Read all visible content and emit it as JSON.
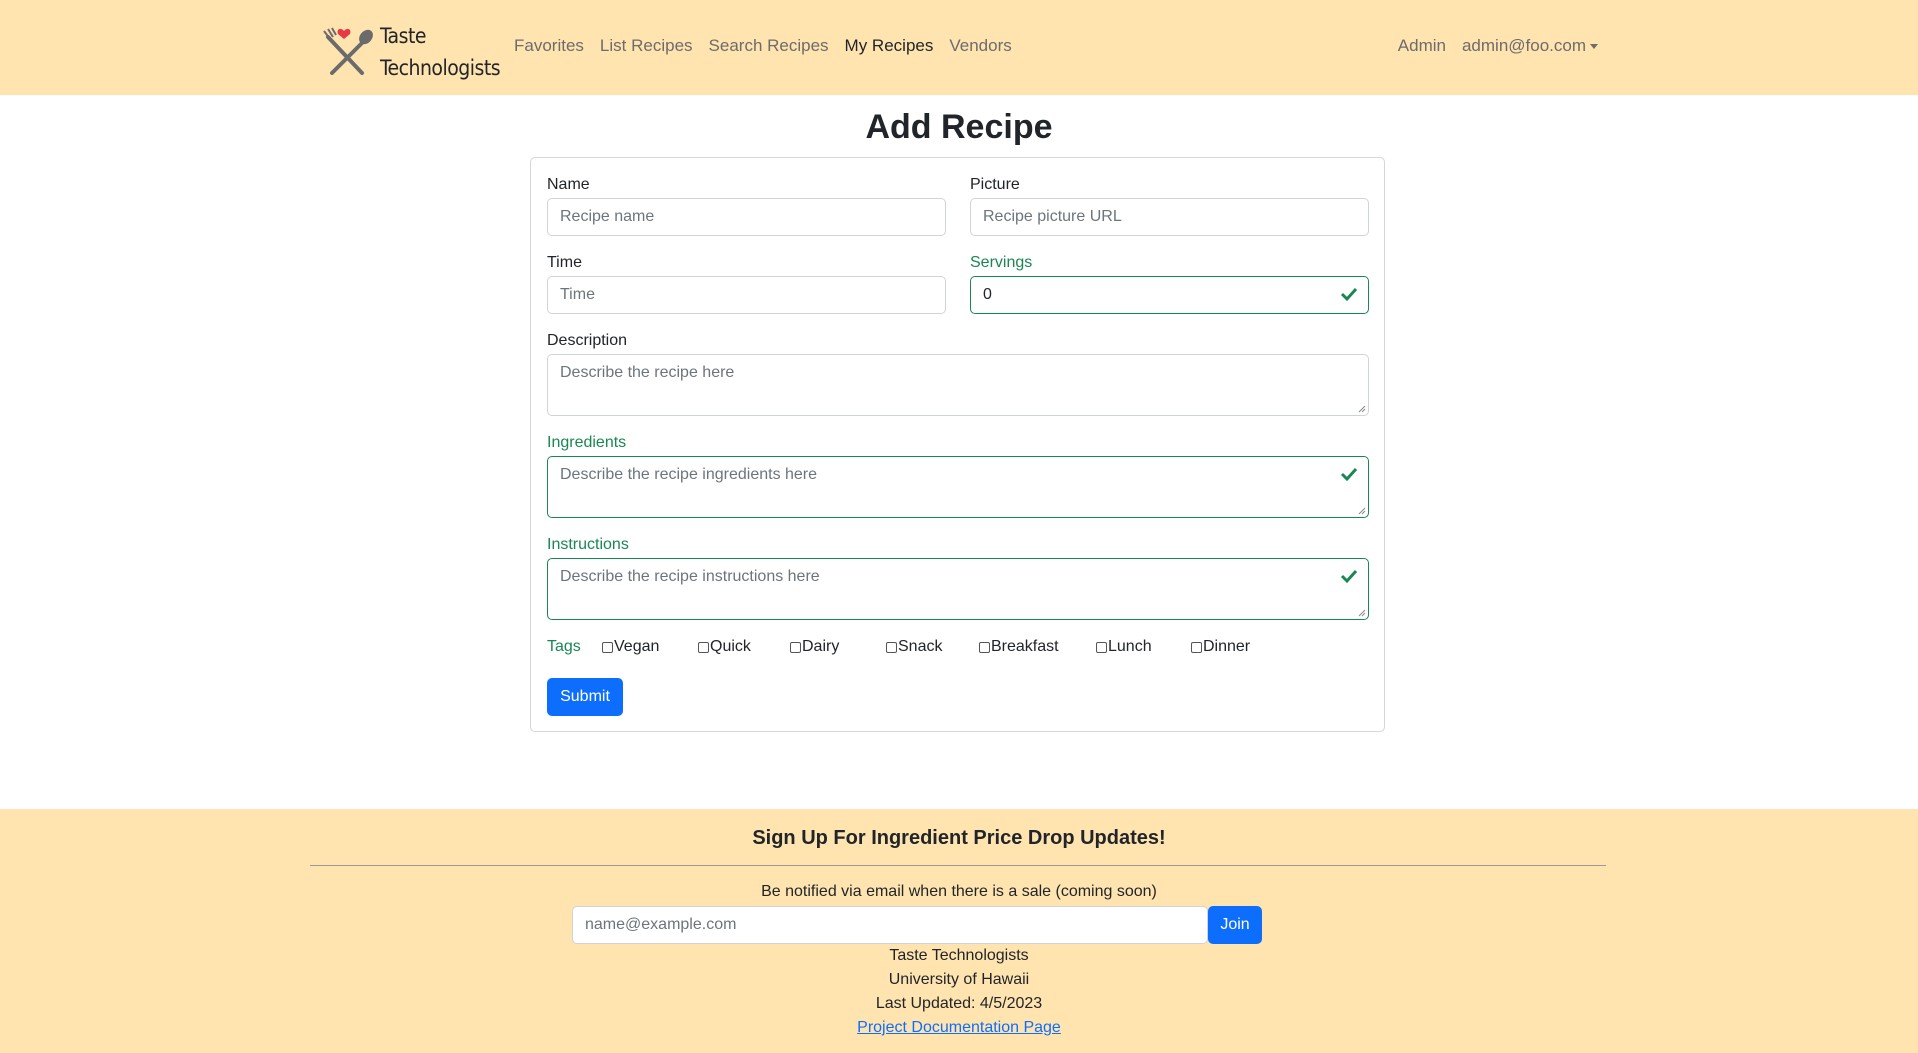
{
  "brand": {
    "line1": "Taste",
    "line2": "Technologists"
  },
  "nav": {
    "links": [
      "Favorites",
      "List Recipes",
      "Search Recipes",
      "My Recipes",
      "Vendors"
    ],
    "admin": "Admin",
    "user": "admin@foo.com"
  },
  "form": {
    "title": "Add Recipe",
    "name_label": "Name",
    "name_placeholder": "Recipe name",
    "picture_label": "Picture",
    "picture_placeholder": "Recipe picture URL",
    "time_label": "Time",
    "time_placeholder": "Time",
    "servings_label": "Servings",
    "servings_value": "0",
    "description_label": "Description",
    "description_placeholder": "Describe the recipe here",
    "ingredients_label": "Ingredients",
    "ingredients_placeholder": "Describe the recipe ingredients here",
    "instructions_label": "Instructions",
    "instructions_placeholder": "Describe the recipe instructions here",
    "tags_label": "Tags",
    "tags": [
      "Vegan",
      "Quick",
      "Dairy",
      "Snack",
      "Breakfast",
      "Lunch",
      "Dinner"
    ],
    "submit_label": "Submit"
  },
  "footer": {
    "heading": "Sign Up For Ingredient Price Drop Updates!",
    "notify_text": "Be notified via email when there is a sale (coming soon)",
    "email_placeholder": "name@example.com",
    "join_label": "Join",
    "org": "Taste Technologists",
    "university": "University of Hawaii",
    "updated": "Last Updated: 4/5/2023",
    "doc_link": "Project Documentation Page"
  },
  "colors": {
    "nav_bg": "#ffe4b0",
    "valid": "#198754",
    "primary": "#0d6efd"
  }
}
